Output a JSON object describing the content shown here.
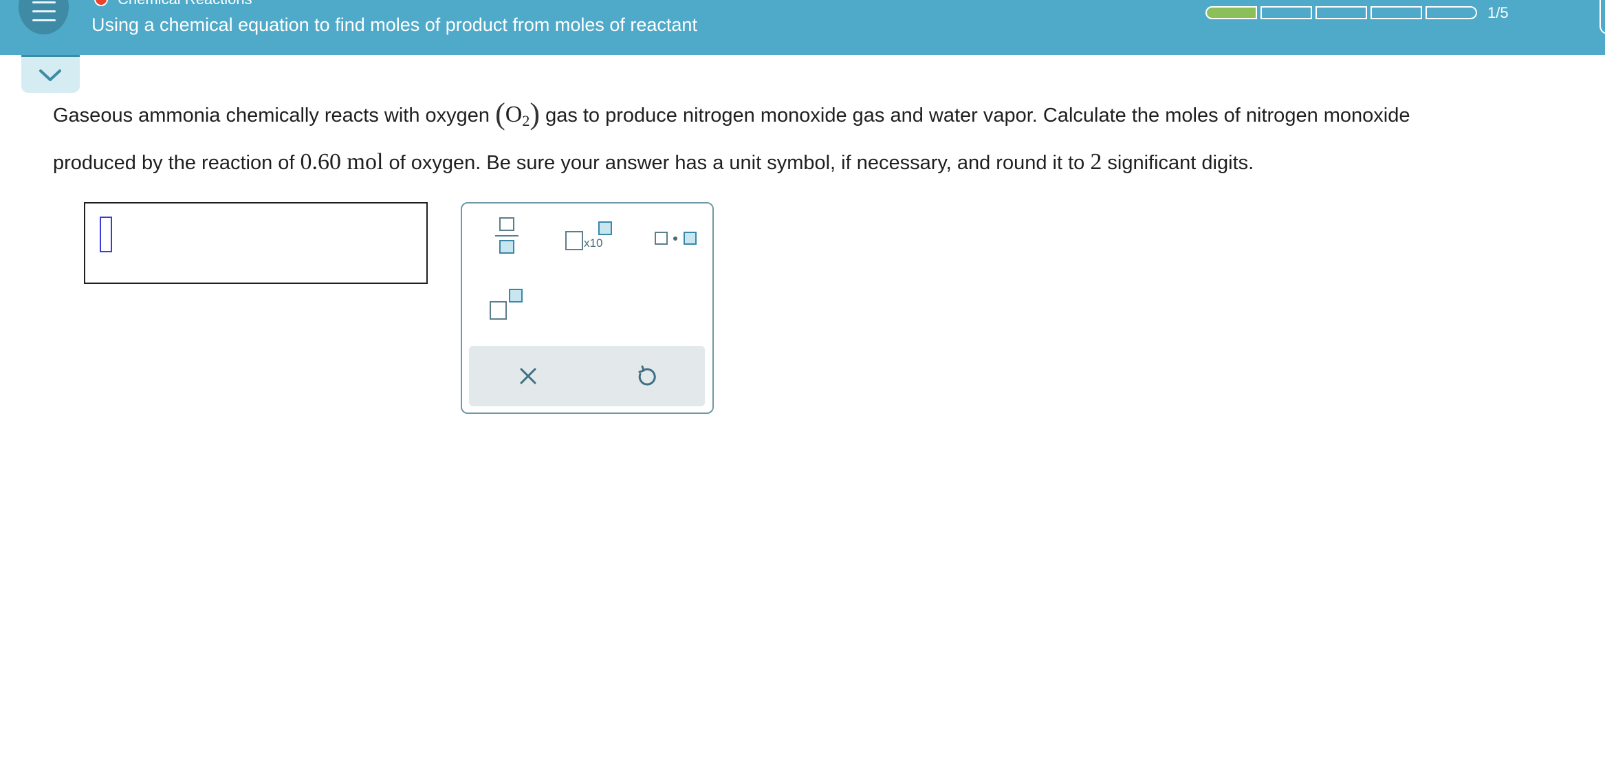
{
  "header": {
    "topic": "Chemical Reactions",
    "title": "Using a chemical equation to find moles of product from moles of reactant",
    "progress": {
      "current": 1,
      "total": 5,
      "label": "1/5"
    }
  },
  "question": {
    "part1": "Gaseous ammonia chemically reacts with oxygen",
    "formula_element": "O",
    "formula_subscript": "2",
    "part2": "gas to produce nitrogen monoxide gas and water vapor. Calculate the moles of nitrogen monoxide",
    "part3": "produced by the reaction of",
    "amount_value": "0.60",
    "amount_unit": "mol",
    "part4": "of oxygen. Be sure your answer has a unit symbol, if necessary, and round it to",
    "sig_figs": "2",
    "part5": "significant digits."
  },
  "answer": {
    "value": ""
  },
  "palette": {
    "x10_label": "x10",
    "tools": [
      "fraction-icon",
      "scientific-notation-icon",
      "multiplication-dot-icon",
      "superscript-icon"
    ],
    "actions": [
      "clear-icon",
      "undo-icon"
    ]
  },
  "colors": {
    "header": "#4fa9c9",
    "progress_done": "#8bbf5a",
    "topic_dot": "#e8432b",
    "caret": "#3b3bd8"
  }
}
